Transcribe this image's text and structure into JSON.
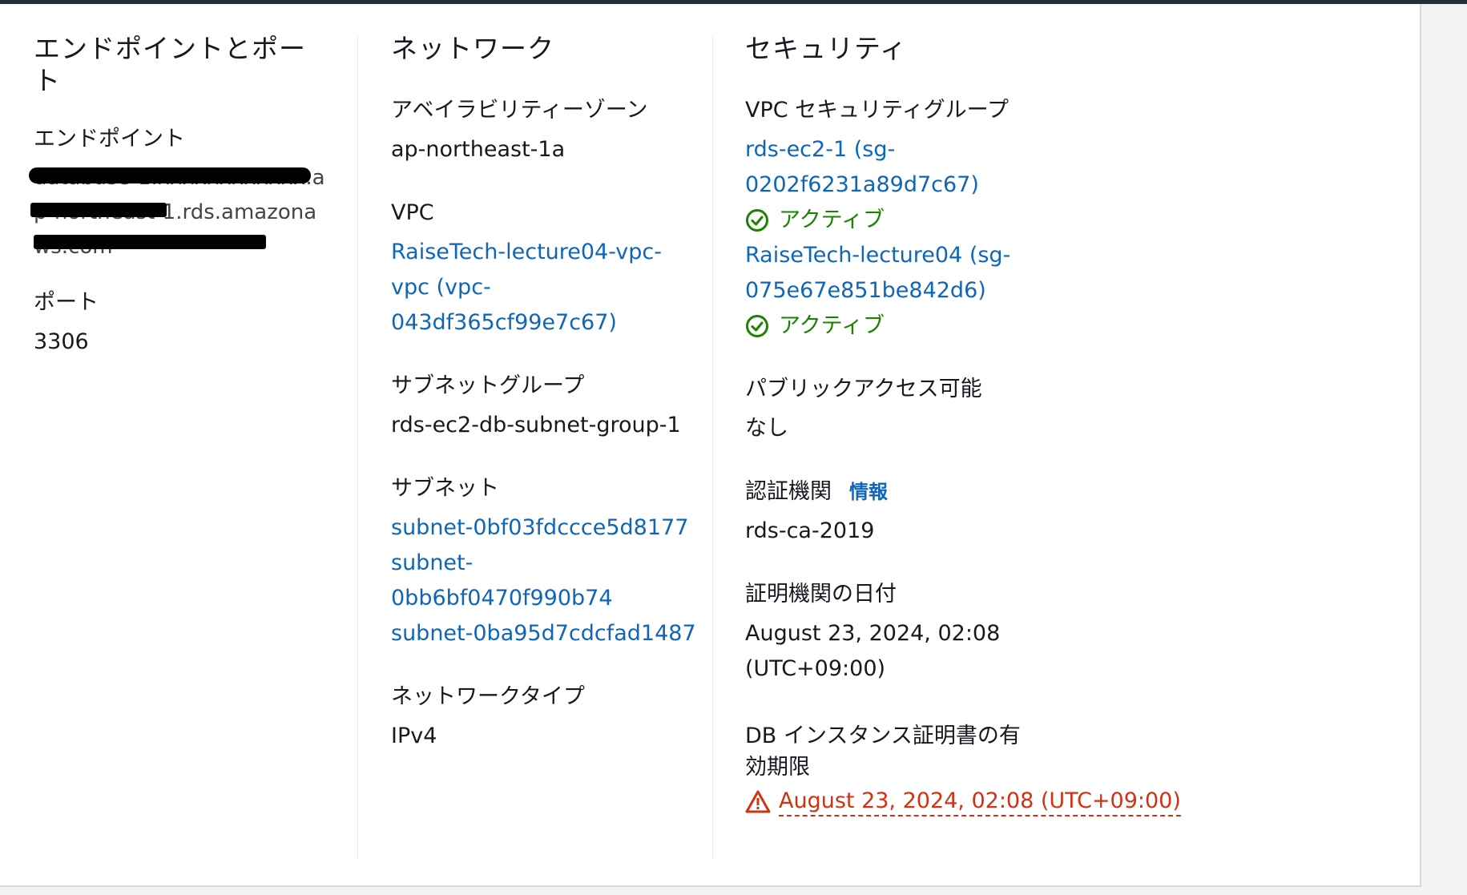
{
  "columns": {
    "endpoint": {
      "title": "エンドポイントとポート",
      "endpoint_label": "エンドポイント",
      "endpoint_value": "database-1.xxxxxxxxxxxx.ap-northeast-1.rds.amazonaws.com",
      "port_label": "ポート",
      "port_value": "3306"
    },
    "network": {
      "title": "ネットワーク",
      "az_label": "アベイラビリティーゾーン",
      "az_value": "ap-northeast-1a",
      "vpc_label": "VPC",
      "vpc_value_line1": "RaiseTech-lecture04-vpc-",
      "vpc_value_line2": "vpc (vpc-",
      "vpc_value_line3": "043df365cf99e7c67)",
      "subnet_group_label": "サブネットグループ",
      "subnet_group_value": "rds-ec2-db-subnet-group-1",
      "subnets_label": "サブネット",
      "subnet1": "subnet-0bf03fdccce5d8177",
      "subnet2_line1": "subnet-",
      "subnet2_line2": "0bb6bf0470f990b74",
      "subnet3": "subnet-0ba95d7cdcfad1487",
      "network_type_label": "ネットワークタイプ",
      "network_type_value": "IPv4"
    },
    "security": {
      "title": "セキュリティ",
      "vpc_sg_label": "VPC セキュリティグループ",
      "sg1_line1": "rds-ec2-1 (sg-",
      "sg1_line2": "0202f6231a89d7c67)",
      "sg1_status": "アクティブ",
      "sg2_line1": "RaiseTech-lecture04 (sg-",
      "sg2_line2": "075e67e851be842d6)",
      "sg2_status": "アクティブ",
      "public_access_label": "パブリックアクセス可能",
      "public_access_value": "なし",
      "ca_label": "認証機関",
      "ca_info": "情報",
      "ca_value": "rds-ca-2019",
      "ca_date_label": "証明機関の日付",
      "ca_date_line1": "August 23, 2024, 02:08",
      "ca_date_line2": "(UTC+09:00)",
      "cert_expiry_label_line1": "DB インスタンス証明書の有",
      "cert_expiry_label_line2": "効期限",
      "cert_expiry_value": "August 23, 2024, 02:08 (UTC+09:00)"
    }
  },
  "colors": {
    "link": "#0f66b9",
    "success": "#1d8102",
    "warning": "#d13212"
  },
  "icons": {
    "status_active": "check-circle-icon",
    "warning": "warning-triangle-icon"
  }
}
